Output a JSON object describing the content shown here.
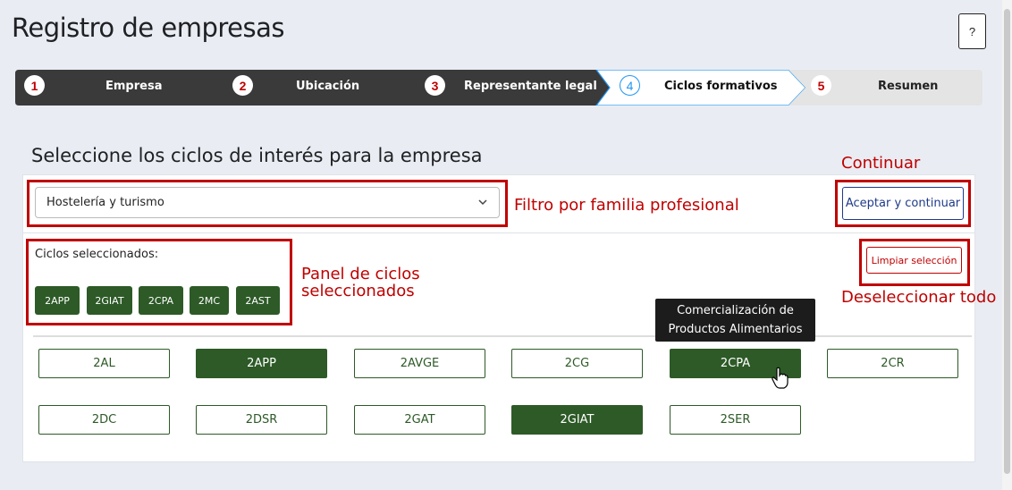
{
  "page": {
    "title": "Registro de empresas",
    "help_label": "?"
  },
  "steps": [
    {
      "num": "1",
      "label": "Empresa",
      "state": "done"
    },
    {
      "num": "2",
      "label": "Ubicación",
      "state": "done"
    },
    {
      "num": "3",
      "label": "Representante legal",
      "state": "done"
    },
    {
      "num": "4",
      "label": "Ciclos formativos",
      "state": "active"
    },
    {
      "num": "5",
      "label": "Resumen",
      "state": "pending"
    }
  ],
  "section": {
    "title": "Seleccione los ciclos de interés para la empresa"
  },
  "filter": {
    "selected_value": "Hostelería y turismo"
  },
  "accept_button": {
    "label": "Aceptar y continuar"
  },
  "selected_panel": {
    "label": "Ciclos seleccionados:",
    "chips": [
      "2APP",
      "2GIAT",
      "2CPA",
      "2MC",
      "2AST"
    ]
  },
  "clear_button": {
    "label": "Limpiar selección"
  },
  "cycles": [
    {
      "code": "2AL",
      "selected": false
    },
    {
      "code": "2APP",
      "selected": true
    },
    {
      "code": "2AVGE",
      "selected": false
    },
    {
      "code": "2CG",
      "selected": false
    },
    {
      "code": "2CPA",
      "selected": true
    },
    {
      "code": "2CR",
      "selected": false
    },
    {
      "code": "2DC",
      "selected": false
    },
    {
      "code": "2DSR",
      "selected": false
    },
    {
      "code": "2GAT",
      "selected": false
    },
    {
      "code": "2GIAT",
      "selected": true
    },
    {
      "code": "2SER",
      "selected": false
    }
  ],
  "tooltip": {
    "line1": "Comercialización de",
    "line2": "Productos Alimentarios"
  },
  "annotations": {
    "continue": "Continuar",
    "filter": "Filtro por familia profesional",
    "panel_line1": "Panel de ciclos",
    "panel_line2": "seleccionados",
    "deselect": "Deseleccionar todo"
  },
  "colors": {
    "stepper_dark": "#3a3a3a",
    "selected_green": "#2d5a27",
    "annotation_red": "#c00000",
    "active_blue": "#2196f3"
  }
}
